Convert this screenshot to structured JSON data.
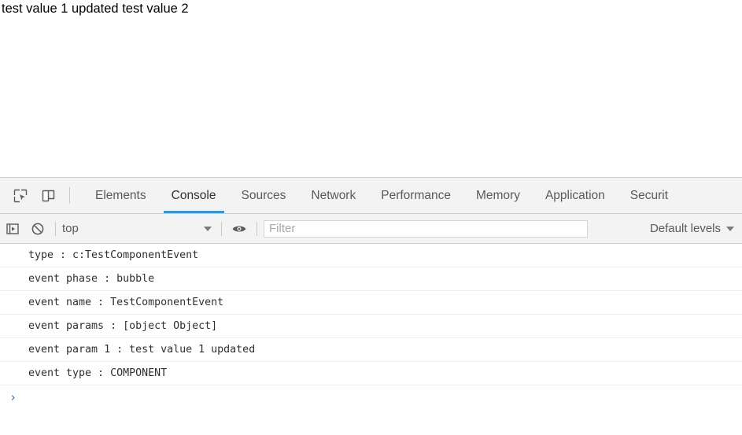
{
  "page": {
    "text": "test value 1 updated test value 2"
  },
  "devtools": {
    "toolbar_icons": {
      "inspect": "inspect-element-icon",
      "device": "device-toolbar-icon"
    },
    "tabs": [
      {
        "label": "Elements",
        "active": false
      },
      {
        "label": "Console",
        "active": true
      },
      {
        "label": "Sources",
        "active": false
      },
      {
        "label": "Network",
        "active": false
      },
      {
        "label": "Performance",
        "active": false
      },
      {
        "label": "Memory",
        "active": false
      },
      {
        "label": "Application",
        "active": false
      },
      {
        "label": "Securit",
        "active": false
      }
    ],
    "active_tab": "Console",
    "accent_color": "#1a9ff5"
  },
  "console_toolbar": {
    "sidebar_toggle_icon": "console-sidebar-icon",
    "clear_icon": "clear-console-icon",
    "context": "top",
    "eye_icon": "live-expression-icon",
    "filter": {
      "value": "",
      "placeholder": "Filter"
    },
    "levels": "Default levels"
  },
  "console_messages": [
    {
      "text": "type : c:TestComponentEvent"
    },
    {
      "text": "event phase : bubble"
    },
    {
      "text": "event name : TestComponentEvent"
    },
    {
      "text": "event params : [object Object]"
    },
    {
      "text": "event param 1 : test value 1 updated"
    },
    {
      "text": "event type : COMPONENT"
    }
  ],
  "console_prompt": {
    "chevron": "›",
    "value": ""
  }
}
